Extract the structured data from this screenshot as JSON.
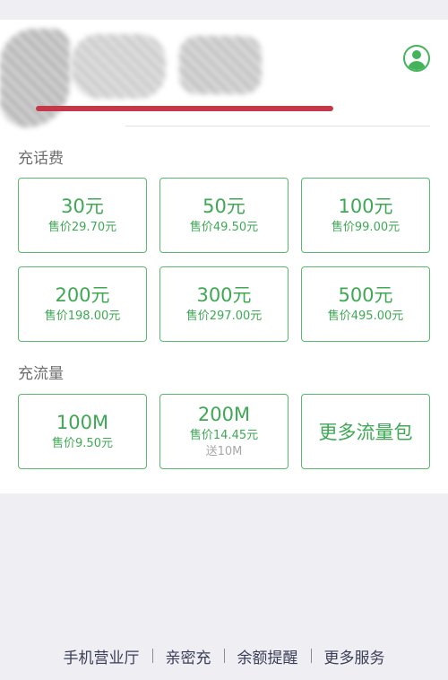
{
  "recharge_section": {
    "title": "充话费",
    "options": [
      {
        "amount": "30元",
        "price": "售价29.70元"
      },
      {
        "amount": "50元",
        "price": "售价49.50元"
      },
      {
        "amount": "100元",
        "price": "售价99.00元"
      },
      {
        "amount": "200元",
        "price": "售价198.00元"
      },
      {
        "amount": "300元",
        "price": "售价297.00元"
      },
      {
        "amount": "500元",
        "price": "售价495.00元"
      }
    ]
  },
  "data_section": {
    "title": "充流量",
    "options": [
      {
        "amount": "100M",
        "price": "售价9.50元"
      },
      {
        "amount": "200M",
        "price": "售价14.45元",
        "bonus": "送10M"
      }
    ],
    "more_label": "更多流量包"
  },
  "bottom_nav": {
    "items": [
      "手机营业厅",
      "亲密充",
      "余额提醒",
      "更多服务"
    ]
  },
  "colors": {
    "accent_green": "#45b35b",
    "background": "#efeef3",
    "redline": "#c4394a"
  },
  "icons": {
    "account": "user-avatar-icon"
  }
}
